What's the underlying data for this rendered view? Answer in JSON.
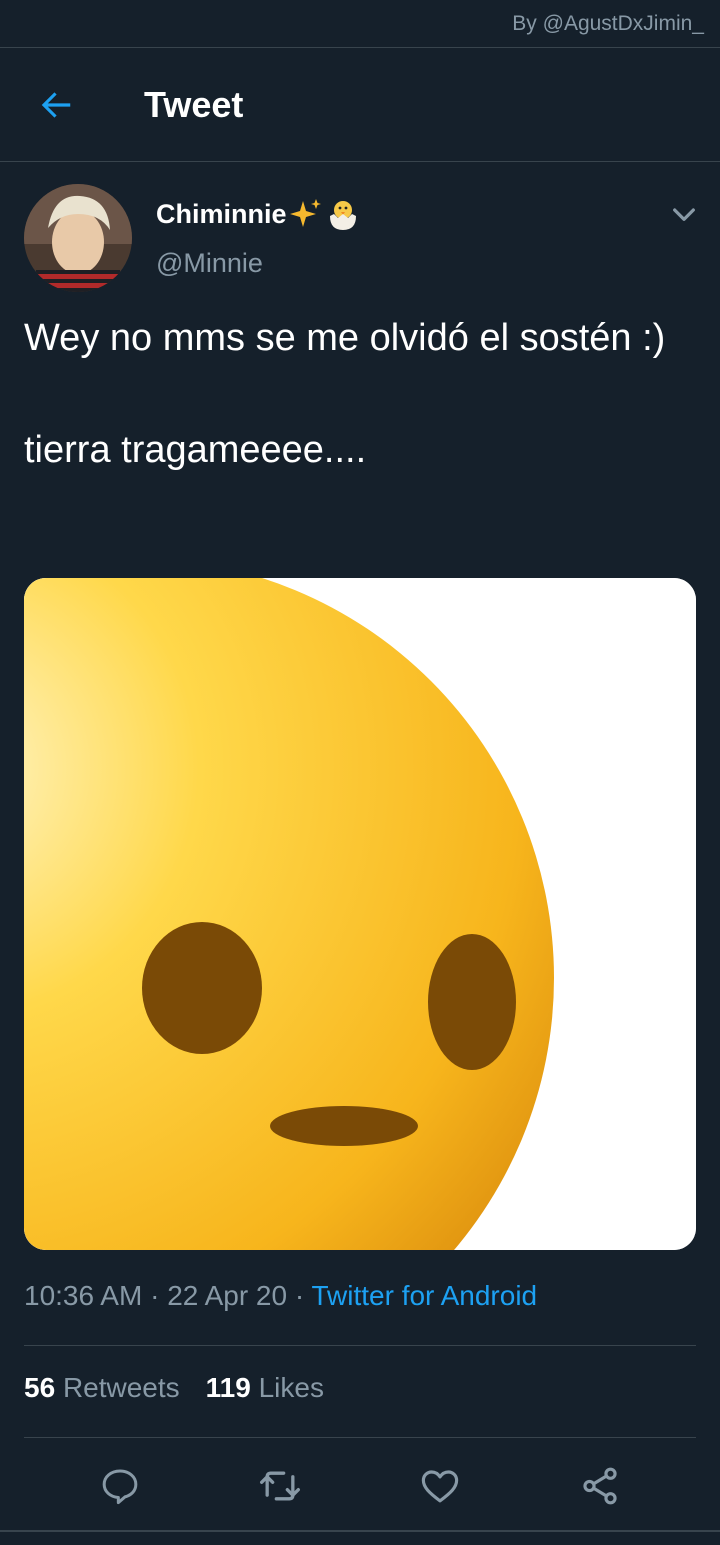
{
  "credit": "By @AgustDxJimin_",
  "header": {
    "title": "Tweet"
  },
  "author": {
    "display_name": "Chiminnie",
    "handle": "@Minnie"
  },
  "tweet": {
    "line1": "Wey no mms se me olvidó el sostén :)",
    "line2": "tierra tragameeee...."
  },
  "meta": {
    "time": "10:36 AM",
    "sep1": " · ",
    "date": "22 Apr 20",
    "sep2": " · ",
    "source": "Twitter for Android"
  },
  "stats": {
    "retweets_count": "56",
    "retweets_label": "Retweets",
    "likes_count": "119",
    "likes_label": "Likes"
  },
  "icons": {
    "back": "arrow-left-icon",
    "more": "chevron-down-icon",
    "reply": "comment-icon",
    "retweet": "retweet-icon",
    "like": "heart-icon",
    "share": "share-icon"
  },
  "colors": {
    "background": "#15202b",
    "accent": "#1da1f2",
    "secondary_text": "#8899a6",
    "divider": "#38444d"
  }
}
